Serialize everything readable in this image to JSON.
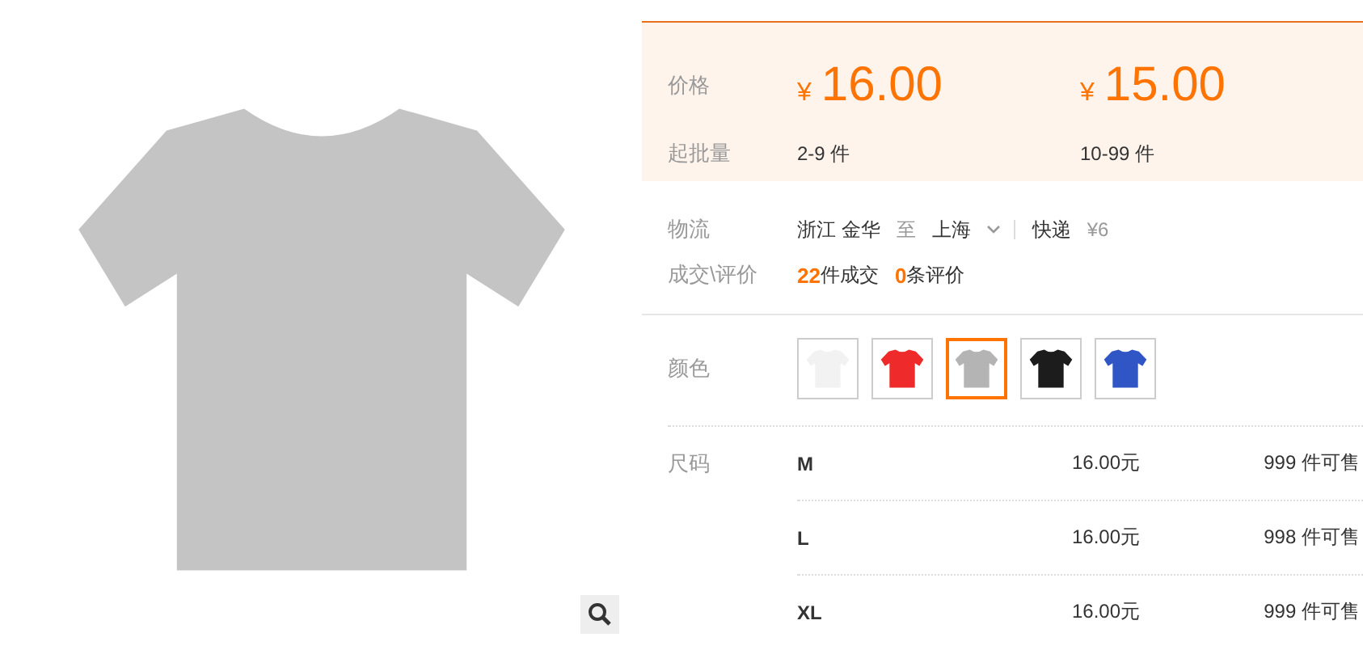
{
  "price_block": {
    "label_price": "价格",
    "label_moq": "起批量",
    "tiers": [
      {
        "currency": "¥",
        "price": "16.00",
        "range": "2-9 件"
      },
      {
        "currency": "¥",
        "price": "15.00",
        "range": "10-99 件"
      }
    ]
  },
  "logistics": {
    "label": "物流",
    "from": "浙江 金华",
    "to_word": "至",
    "to": "上海",
    "method": "快递",
    "fee": "¥6"
  },
  "deals": {
    "label": "成交\\评价",
    "sold_count": "22",
    "sold_text": "件成交",
    "review_count": "0",
    "review_text": "条评价"
  },
  "colors": {
    "label": "颜色",
    "swatches": [
      {
        "color": "#f2f2f2",
        "selected": false
      },
      {
        "color": "#ee2a2a",
        "selected": false
      },
      {
        "color": "#b4b4b4",
        "selected": true
      },
      {
        "color": "#1c1c1c",
        "selected": false
      },
      {
        "color": "#2f56c4",
        "selected": false
      }
    ]
  },
  "sizes": {
    "label": "尺码",
    "rows": [
      {
        "size": "M",
        "price": "16.00元",
        "stock": "999",
        "stock_text": "件可售"
      },
      {
        "size": "L",
        "price": "16.00元",
        "stock": "998",
        "stock_text": "件可售"
      },
      {
        "size": "XL",
        "price": "16.00元",
        "stock": "999",
        "stock_text": "件可售"
      }
    ]
  }
}
